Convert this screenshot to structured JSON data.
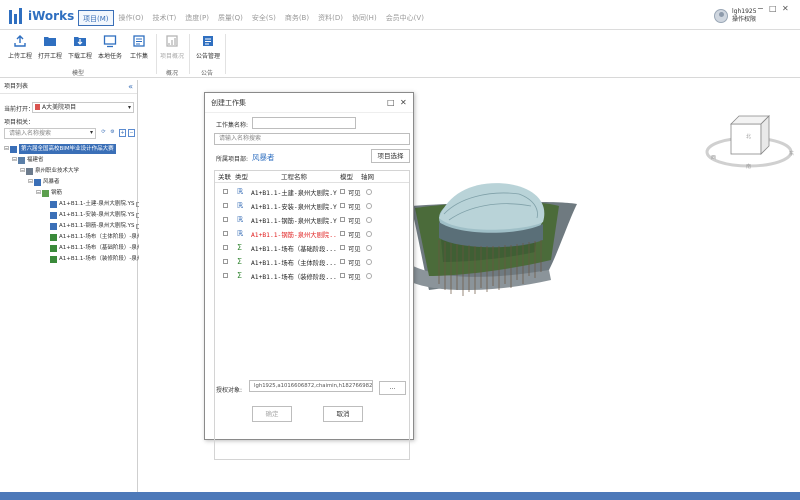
{
  "app": {
    "title": "iWorks",
    "menu": [
      {
        "label": "项目(M)",
        "active": true
      },
      {
        "label": "操作(O)"
      },
      {
        "label": "技术(T)"
      },
      {
        "label": "造度(P)"
      },
      {
        "label": "质量(Q)"
      },
      {
        "label": "安全(S)"
      },
      {
        "label": "商务(B)"
      },
      {
        "label": "资料(D)"
      },
      {
        "label": "协同(H)"
      },
      {
        "label": "会员中心(V)"
      }
    ],
    "user": {
      "name": "lgh1925",
      "action": "操作权限"
    },
    "window_controls": {
      "min": "−",
      "max": "□",
      "close": "✕"
    }
  },
  "ribbon": {
    "groups": [
      {
        "label": "模型",
        "buttons": [
          "上传工程",
          "打开工程",
          "下载工程",
          "本地任务",
          "工作集"
        ]
      },
      {
        "label": "概况",
        "buttons": [
          "项目概况"
        ]
      },
      {
        "label": "公告",
        "buttons": [
          "公告管理"
        ]
      }
    ]
  },
  "left_panel": {
    "title": "项目列表",
    "collapse": "«",
    "current_open_label": "当前打开：",
    "current_open_value": "A大美院项目",
    "project_related_label": "项目相关：",
    "search_placeholder": "请输入名称搜索",
    "tree": [
      {
        "label": "第六届全国高校BIM毕业设计作品大赛",
        "level": 0,
        "selected": true
      },
      {
        "label": "福建省",
        "level": 1
      },
      {
        "label": "泉州职业技术大学",
        "level": 2
      },
      {
        "label": "风暴者",
        "level": 3
      },
      {
        "label": "钢筋",
        "level": 4
      },
      {
        "label": "A1+B1.1-土建-泉州大剧院.YS",
        "level": 5
      },
      {
        "label": "A1+B1.1-安装-泉州大剧院.YS",
        "level": 5
      },
      {
        "label": "A1+B1.1-钢筋-泉州大剧院.YS",
        "level": 5
      },
      {
        "label": "A1+B1.1-场布（主体阶段）-泉州",
        "level": 5
      },
      {
        "label": "A1+B1.1-场布（基础阶段）-泉州",
        "level": 5
      },
      {
        "label": "A1+B1.1-场布（装修阶段）-泉州",
        "level": 5
      }
    ]
  },
  "dialog": {
    "title": "创建工作集",
    "name_label": "工作集名称:",
    "name_value": "",
    "search_placeholder": "请输入名称搜索",
    "project_label": "所属项目部:",
    "project_value": "风暴者",
    "project_select_btn": "项目选择",
    "columns": [
      "关联",
      "类型",
      "工程名称",
      "模型",
      "轴网"
    ],
    "rows": [
      {
        "name": "A1+B1.1-土建-泉州大剧院.YS",
        "model": "可见",
        "color": "#222222"
      },
      {
        "name": "A1+B1.1-安装-泉州大剧院.YS",
        "model": "可见",
        "color": "#222222"
      },
      {
        "name": "A1+B1.1-钢筋-泉州大剧院.YS",
        "model": "可见",
        "color": "#222222"
      },
      {
        "name": "A1+B1.1-钢筋-泉州大剧院...",
        "model": "可见",
        "color": "#e02020"
      },
      {
        "name": "A1+B1.1-场布（基础阶段...",
        "model": "可见",
        "color": "#222222"
      },
      {
        "name": "A1+B1.1-场布（主体阶段...",
        "model": "可见",
        "color": "#222222"
      },
      {
        "name": "A1+B1.1-场布（装修阶段...",
        "model": "可见",
        "color": "#222222"
      }
    ],
    "auth_label": "授权对象:",
    "auth_value": "lgh1925,a1016606872,chaimin,h1827669829,lb020",
    "auth_btn": "...",
    "confirm_btn": "确定",
    "cancel_btn": "取消"
  },
  "viewcube": {
    "ring_labels": [
      "东",
      "南",
      "西",
      "北"
    ]
  }
}
